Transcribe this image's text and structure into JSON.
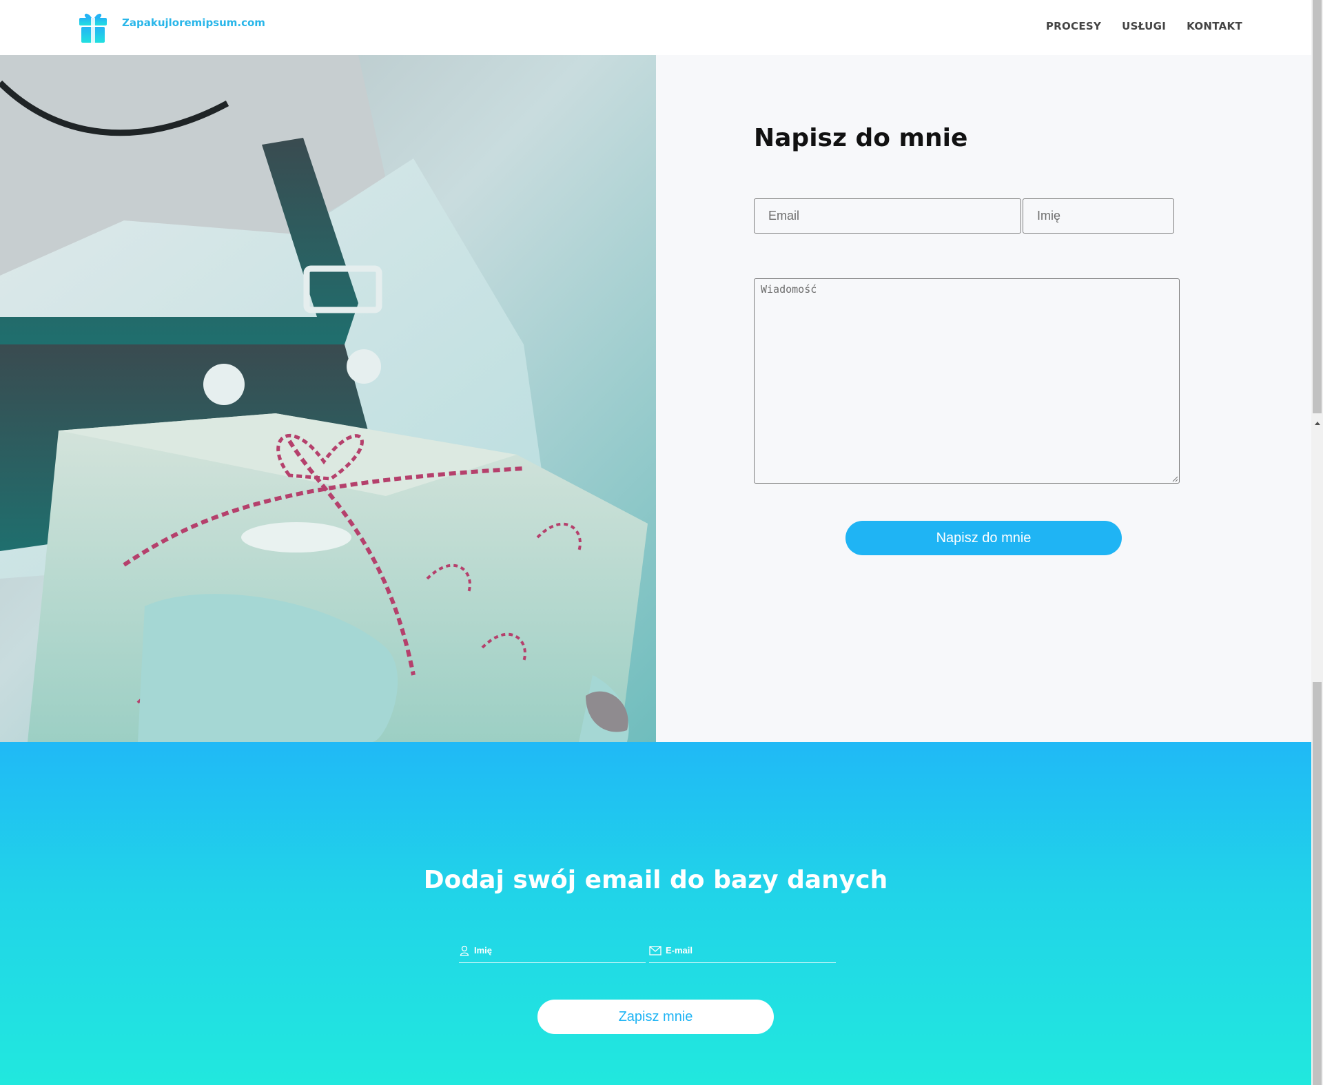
{
  "header": {
    "logo_text": "Zapakujloremipsum.com",
    "logo_icon": "gift-icon",
    "nav": [
      {
        "label": "PROCESY"
      },
      {
        "label": "USŁUGI"
      },
      {
        "label": "KONTAKT"
      }
    ]
  },
  "contact": {
    "title": "Napisz do mnie",
    "email_placeholder": "Email",
    "name_placeholder": "Imię",
    "message_placeholder": "Wiadomość",
    "submit_label": "Napisz do mnie"
  },
  "newsletter": {
    "title": "Dodaj swój email do bazy danych",
    "name_placeholder": "Imię",
    "email_placeholder": "E-mail",
    "name_icon": "user-icon",
    "email_icon": "envelope-icon",
    "submit_label": "Zapisz mnie"
  },
  "colors": {
    "accent": "#1fb4f4",
    "logo": "#29b6e9",
    "gradient_top": "#20b9f6",
    "gradient_bottom": "#21e8de",
    "panel_bg": "#f7f8fa"
  }
}
